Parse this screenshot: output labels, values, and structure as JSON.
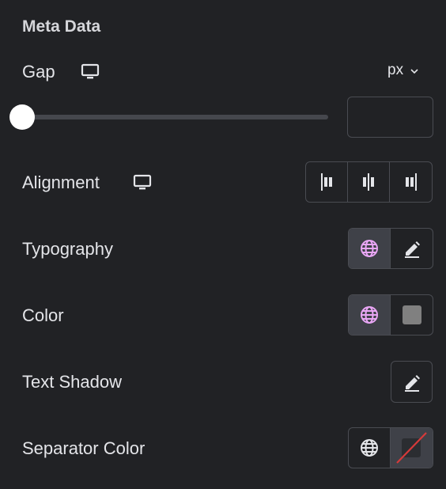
{
  "section": {
    "title": "Meta Data"
  },
  "gap": {
    "label": "Gap",
    "unit": "px",
    "value": "",
    "slider_value": 0
  },
  "alignment": {
    "label": "Alignment",
    "options": [
      "left",
      "center",
      "right"
    ]
  },
  "typography": {
    "label": "Typography"
  },
  "color": {
    "label": "Color",
    "swatch": "#808080"
  },
  "text_shadow": {
    "label": "Text Shadow"
  },
  "separator_color": {
    "label": "Separator Color"
  },
  "colors": {
    "background": "#212225",
    "border": "#4a4c52",
    "active_segment": "#3f4148",
    "global_icon_active": "#e9a6f5",
    "clear_stroke": "#d63a3a"
  }
}
